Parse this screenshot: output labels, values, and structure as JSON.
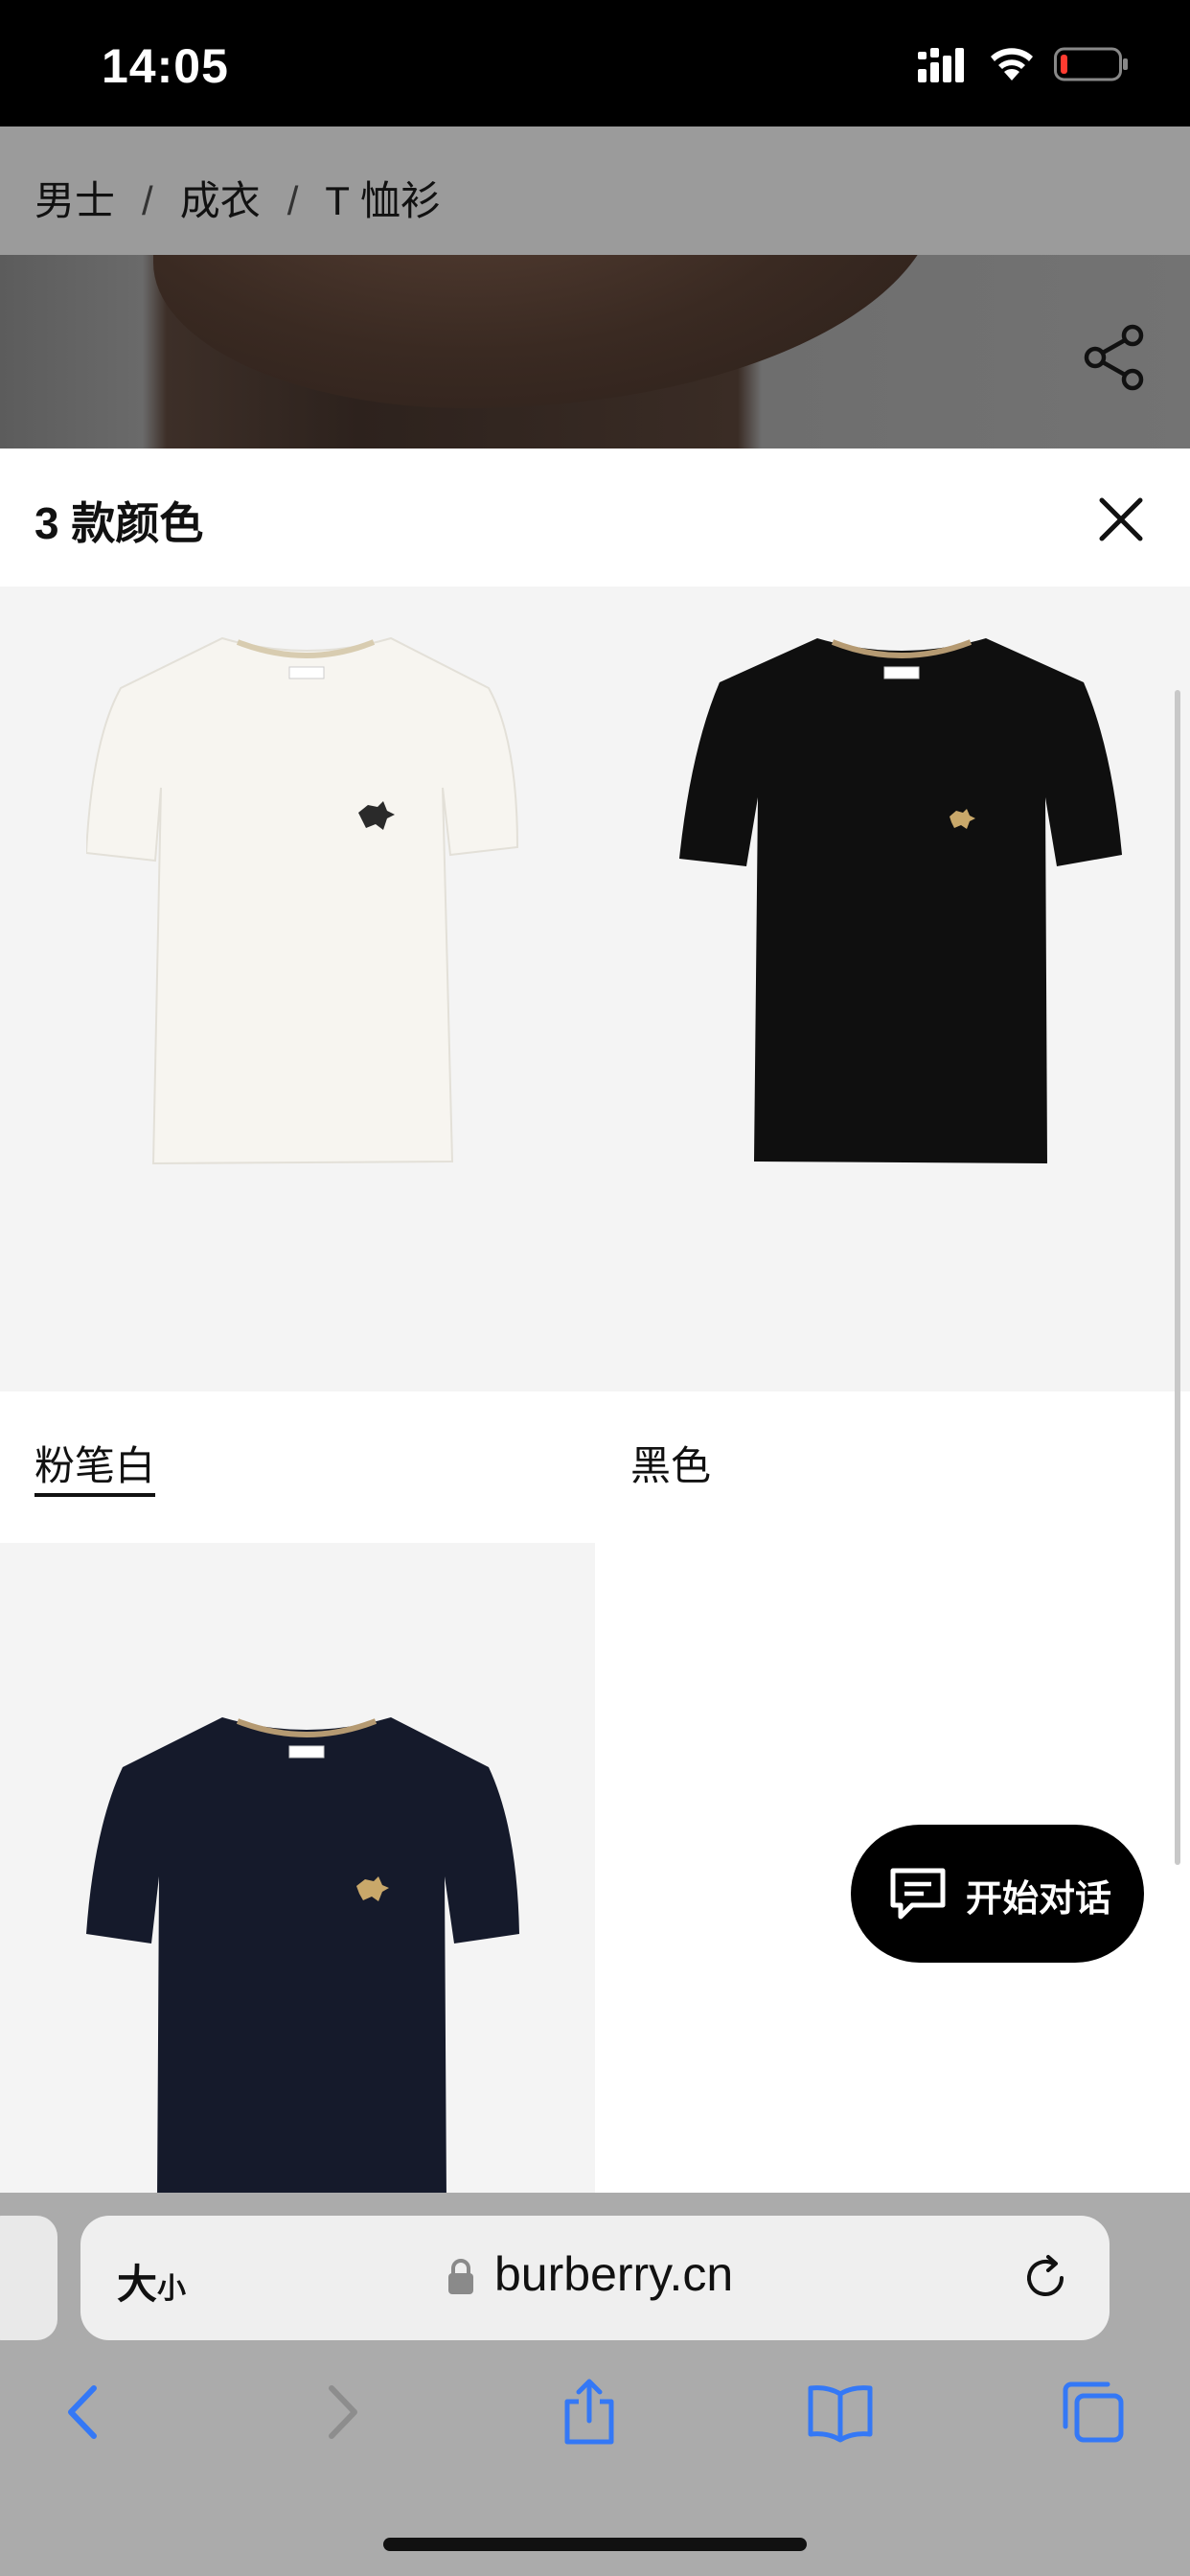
{
  "status_bar": {
    "time": "14:05"
  },
  "breadcrumb": {
    "items": [
      "男士",
      "成衣",
      "T 恤衫"
    ],
    "separator": "/"
  },
  "sheet": {
    "title": "3 款颜色",
    "colors": [
      {
        "label": "粉笔白",
        "shirt_color": "#f7f5f0",
        "emblem_color": "#2a2a2a",
        "selected": true
      },
      {
        "label": "黑色",
        "shirt_color": "#0f0f0f",
        "emblem_color": "#c9a86a",
        "selected": false
      },
      {
        "label": "",
        "shirt_color": "#151a2b",
        "emblem_color": "#c9a86a",
        "selected": false
      }
    ]
  },
  "chat": {
    "label": "开始对话"
  },
  "browser": {
    "text_size_big": "大",
    "text_size_small": "小",
    "url": "burberry.cn"
  },
  "colors": {
    "accent": "#3478f6",
    "status_bar_bg": "#000000",
    "sheet_bg": "#ffffff",
    "tile_bg": "#f4f4f4"
  }
}
